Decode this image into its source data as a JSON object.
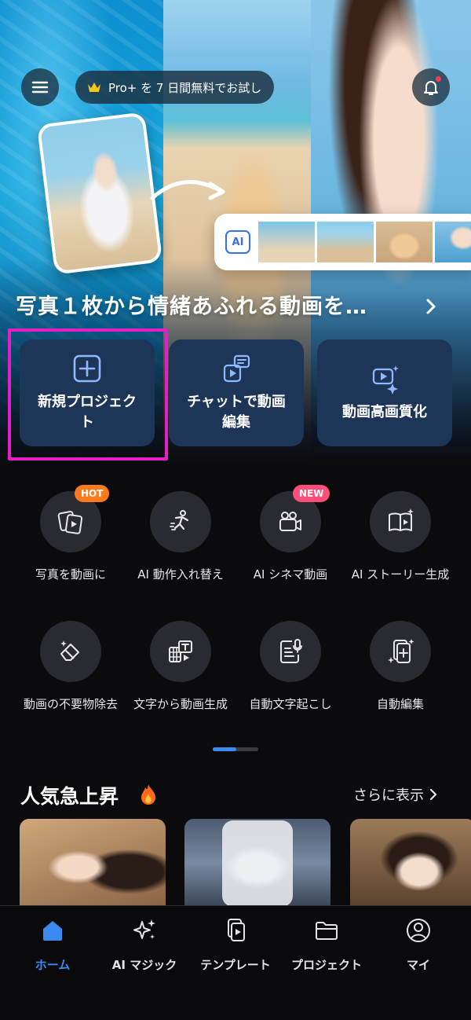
{
  "header": {
    "pro_promo": "Pro+ を 7 日間無料でお試し"
  },
  "hero": {
    "ai_chip": "AI",
    "title": "写真１枚から情緒あふれる動画を…"
  },
  "actions": [
    {
      "label": "新規プロジェクト"
    },
    {
      "label": "チャットで動画編集"
    },
    {
      "label": "動画高画質化"
    }
  ],
  "features": [
    {
      "label": "写真を動画に",
      "badge": "HOT",
      "icon": "photo-to-video-icon"
    },
    {
      "label": "AI 動作入れ替え",
      "badge": "",
      "icon": "motion-swap-icon"
    },
    {
      "label": "AI シネマ動画",
      "badge": "NEW",
      "icon": "cinema-camera-icon"
    },
    {
      "label": "AI ストーリー生成",
      "badge": "",
      "icon": "story-book-icon"
    },
    {
      "label": "動画の不要物除去",
      "badge": "",
      "icon": "eraser-icon"
    },
    {
      "label": "文字から動画生成",
      "badge": "",
      "icon": "text-to-video-icon"
    },
    {
      "label": "自動文字起こし",
      "badge": "",
      "icon": "transcribe-mic-icon"
    },
    {
      "label": "自動編集",
      "badge": "",
      "icon": "auto-edit-icon"
    }
  ],
  "pager": {
    "page": 1,
    "pages": 2
  },
  "trending": {
    "title": "人気急上昇",
    "more": "さらに表示"
  },
  "nav": [
    {
      "label": "ホーム",
      "icon": "home-icon",
      "active": true
    },
    {
      "label": "AI マジック",
      "icon": "sparkle-icon",
      "active": false
    },
    {
      "label": "テンプレート",
      "icon": "template-icon",
      "active": false
    },
    {
      "label": "プロジェクト",
      "icon": "folder-icon",
      "active": false
    },
    {
      "label": "マイ",
      "icon": "profile-icon",
      "active": false
    }
  ],
  "colors": {
    "accent": "#3b8af0",
    "card": "#1d3657",
    "highlight": "#e41fc6",
    "hot": "#ff7a1a",
    "new": "#ff4e7a"
  }
}
